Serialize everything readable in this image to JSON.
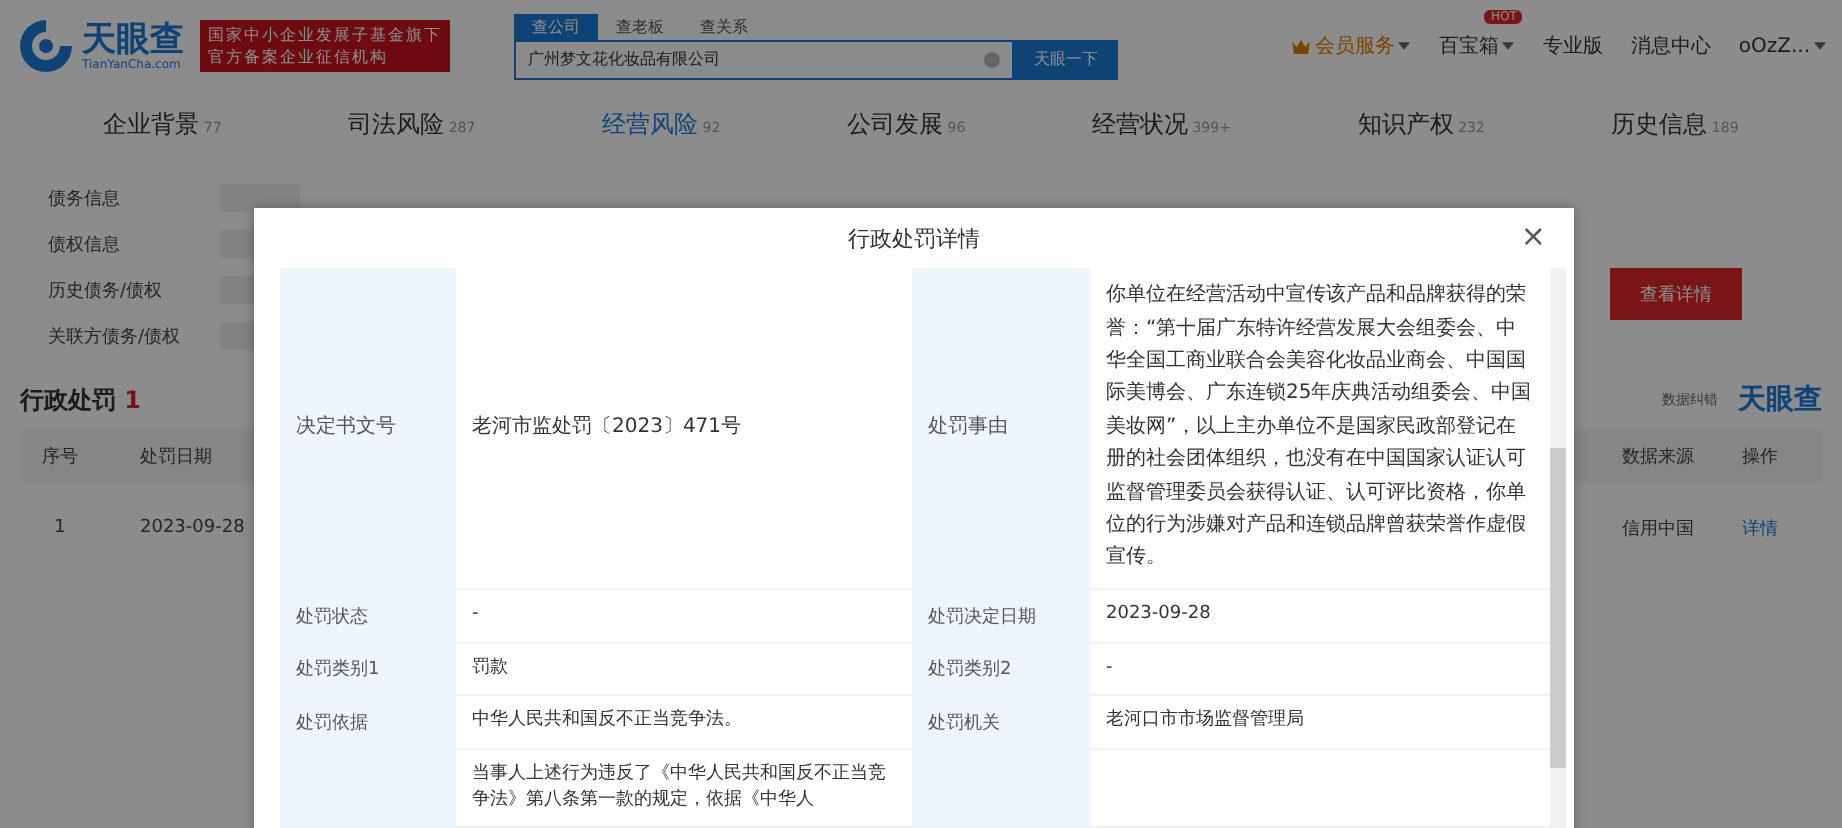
{
  "header": {
    "logo": {
      "name": "天眼查",
      "domain": "TianYanCha.com"
    },
    "banner": [
      "国家中小企业发展子基金旗下",
      "官方备案企业征信机构"
    ],
    "search_tabs": [
      {
        "label": "查公司",
        "selected": true
      },
      {
        "label": "查老板",
        "selected": false
      },
      {
        "label": "查关系",
        "selected": false
      }
    ],
    "search": {
      "value": "广州梦文花化妆品有限公司",
      "button": "天眼一下"
    },
    "menu": [
      {
        "label": "会员服务",
        "kind": "vip"
      },
      {
        "label": "百宝箱",
        "kind": "dropdown",
        "badge": "HOT"
      },
      {
        "label": "专业版",
        "kind": "plain"
      },
      {
        "label": "消息中心",
        "kind": "plain"
      },
      {
        "label": "oOzZ...",
        "kind": "dropdown"
      }
    ]
  },
  "nav_tabs": [
    {
      "label": "企业背景",
      "count": "77",
      "selected": false
    },
    {
      "label": "司法风险",
      "count": "287",
      "selected": false
    },
    {
      "label": "经营风险",
      "count": "92",
      "selected": true
    },
    {
      "label": "公司发展",
      "count": "96",
      "selected": false
    },
    {
      "label": "经营状况",
      "count": "399+",
      "selected": false
    },
    {
      "label": "知识产权",
      "count": "232",
      "selected": false
    },
    {
      "label": "历史信息",
      "count": "189",
      "selected": false
    }
  ],
  "sidebar": {
    "items": [
      "债务信息",
      "债权信息",
      "历史债务/债权",
      "关联方债务/债权"
    ],
    "button": "查看详情"
  },
  "section": {
    "title": "行政处罚",
    "count": "1",
    "report": "数据纠错",
    "watermark_logo": "天眼查",
    "columns": [
      "序号",
      "处罚日期",
      "数据来源",
      "操作"
    ],
    "rows": [
      {
        "index": "1",
        "date": "2023-09-28",
        "source": "信用中国",
        "action": "详情"
      }
    ]
  },
  "modal": {
    "title": "行政处罚详情",
    "close": "×",
    "rows": [
      [
        {
          "label": "决定书文号",
          "value": "老河市监处罚〔2023〕471号"
        },
        {
          "label": "处罚事由",
          "value": "你单位在经营活动中宣传该产品和品牌获得的荣誉：“第十届广东特许经营发展大会组委会、中华全国工商业联合会美容化妆品业商会、中国国际美博会、广东连锁25年庆典活动组委会、中国美妆网”，以上主办单位不是国家民政部登记在册的社会团体组织，也没有在中国国家认证认可监督管理委员会获得认证、认可评比资格，你单位的行为涉嫌对产品和连锁品牌曾获荣誉作虚假宣传。"
        }
      ],
      [
        {
          "label": "处罚状态",
          "value": "-"
        },
        {
          "label": "处罚决定日期",
          "value": "2023-09-28"
        }
      ],
      [
        {
          "label": "处罚类别1",
          "value": "罚款"
        },
        {
          "label": "处罚类别2",
          "value": "-"
        }
      ],
      [
        {
          "label": "处罚依据",
          "value": "中华人民共和国反不正当竞争法。"
        },
        {
          "label": "处罚机关",
          "value": "老河口市市场监督管理局"
        }
      ],
      [
        {
          "value": "当事人上述行为违反了《中华人民共和国反不正当竞争法》第八条第一款的规定，依据《中华人"
        }
      ]
    ]
  }
}
